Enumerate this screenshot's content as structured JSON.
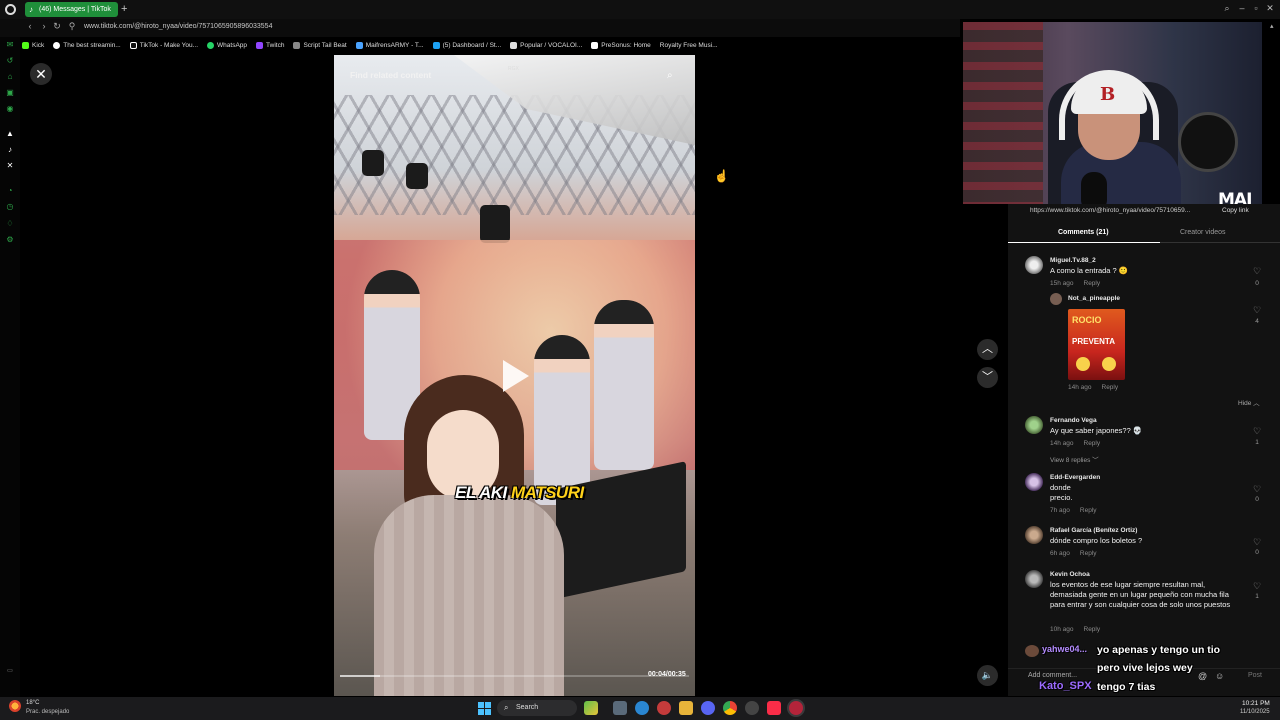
{
  "browser": {
    "tab_title": "(46) Messages | TikTok",
    "url": "www.tiktok.com/@hiroto_nyaa/video/7571065905896033554",
    "bookmarks": [
      "Kick",
      "The best streamin...",
      "TikTok - Make You...",
      "WhatsApp",
      "Twitch",
      "Script Tail Beat",
      "MaifrensARMY - T...",
      "(5) Dashboard / St...",
      "Popular / VOCALOI...",
      "PreSonus: Home",
      "Royalty Free Musi..."
    ]
  },
  "video": {
    "find_related": "Find related content",
    "watermark": "RGX",
    "caption_white": "EL AKI ",
    "caption_yellow": "MATSURI",
    "time": "00:04/00:35",
    "progress": 0.114
  },
  "webcam": {
    "logo": "MAI"
  },
  "panel": {
    "share_url": "https://www.tiktok.com/@hiroto_nyaa/video/75710659...",
    "copy_link": "Copy link",
    "tab_comments": "Comments (21)",
    "tab_creator": "Creator videos",
    "hide_label": "Hide",
    "add_comment": "Add comment...",
    "post": "Post"
  },
  "comments": [
    {
      "user": "Miguel.Tv.88_2",
      "text": "A como la entrada ? 🙂",
      "age": "15h ago",
      "reply": "Reply",
      "likes": "0"
    },
    {
      "user": "Not_a_pineapple",
      "age": "14h ago",
      "reply": "Reply",
      "likes": "4",
      "image_top": "ROCIO",
      "image_bottom": "PREVENTA"
    },
    {
      "user": "Fernando Vega",
      "text": "Ay que saber japones?? 💀",
      "age": "14h ago",
      "reply": "Reply",
      "likes": "1",
      "view_replies": "View 8 replies"
    },
    {
      "user": "Edd-Evergarden",
      "text": "donde\nprecio.",
      "age": "7h ago",
      "reply": "Reply",
      "likes": "0"
    },
    {
      "user": "Rafael García (Benítez Ortiz)",
      "text": "dónde compro los boletos ?",
      "age": "6h ago",
      "reply": "Reply",
      "likes": "0"
    },
    {
      "user": "Kevin Ochoa",
      "text": "los eventos de ese lugar siempre resultan mal, demasiada gente en un lugar pequeño con mucha fila para entrar y son cualquier cosa de solo unos puestos",
      "age": "10h ago",
      "reply": "Reply",
      "likes": "1"
    }
  ],
  "stream_chat": {
    "line1_user": "yahwe04...",
    "line1": "yo apenas y tengo un tio",
    "line2": "pero vive lejos wey",
    "user2": "Kato_SPX",
    "line3": "tengo 7 tias"
  },
  "taskbar": {
    "weather_temp": "18°C",
    "weather_desc": "Prac. despejado",
    "search": "Search",
    "time": "10:21 PM",
    "date": "11/10/2025"
  },
  "colors": {
    "tab_green": "#1f8f3a",
    "sidebar_green": "#2ea84a",
    "caption_yellow": "#ffd21a",
    "chat_user_purple": "#9c6bff"
  }
}
